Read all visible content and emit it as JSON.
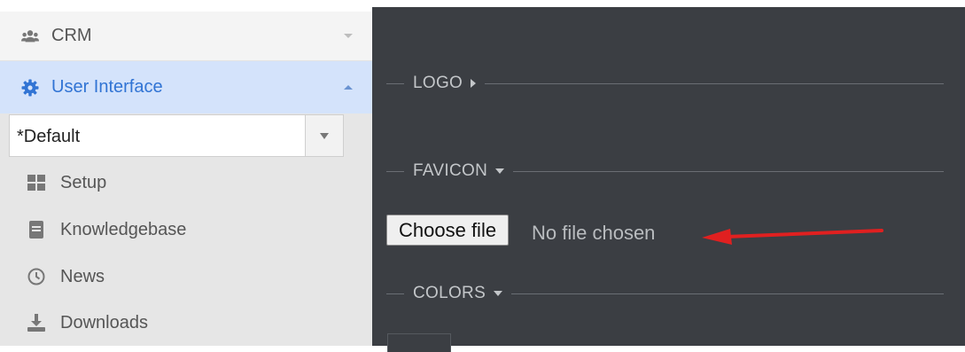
{
  "sidebar": {
    "crm": {
      "label": "CRM",
      "icon": "users-icon"
    },
    "user_interface": {
      "label": "User Interface",
      "icon": "gear-icon",
      "accent": "#3174d4"
    },
    "theme_select": {
      "value": "*Default"
    },
    "items": [
      {
        "label": "Setup",
        "icon": "grid-icon"
      },
      {
        "label": "Knowledgebase",
        "icon": "book-icon"
      },
      {
        "label": "News",
        "icon": "clock-icon"
      },
      {
        "label": "Downloads",
        "icon": "download-icon"
      }
    ]
  },
  "main": {
    "sections": [
      {
        "title": "LOGO",
        "state": "collapsed"
      },
      {
        "title": "FAVICON",
        "state": "expanded"
      },
      {
        "title": "COLORS",
        "state": "expanded"
      }
    ],
    "file_input": {
      "button_label": "Choose file",
      "status": "No file chosen"
    },
    "annotation": {
      "type": "red-arrow",
      "color": "#e02020"
    }
  }
}
